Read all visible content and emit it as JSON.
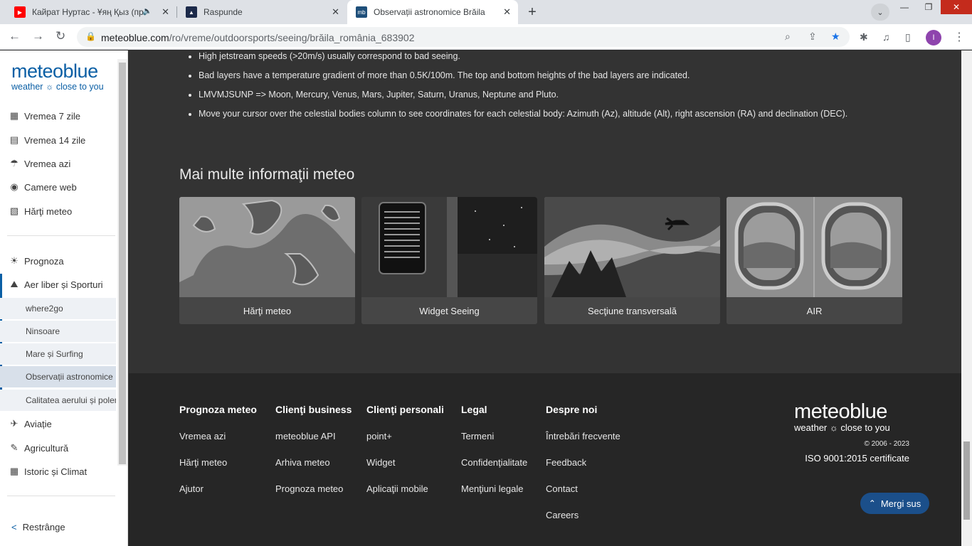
{
  "browser": {
    "tabs": [
      {
        "title": "Кайрат Нуртас - Ұяң Қыз (пр",
        "favicon": "youtube-icon"
      },
      {
        "title": "Raspunde",
        "favicon": "raspunde-icon"
      },
      {
        "title": "Observații astronomice Brăila - m",
        "favicon": "mb-icon",
        "favicon_text": "mb"
      }
    ],
    "url_host": "meteoblue.com",
    "url_path": "/ro/vreme/outdoorsports/seeing/brăila_românia_683902",
    "profile_initial": "I"
  },
  "sidebar": {
    "logo_main": "meteoblue",
    "logo_tagline": "weather ☼ close to you",
    "items_top": [
      {
        "label": "Vremea 7 zile",
        "icon": "calendar-7-icon"
      },
      {
        "label": "Vremea 14 zile",
        "icon": "calendar-14-icon"
      },
      {
        "label": "Vremea azi",
        "icon": "weather-today-icon"
      },
      {
        "label": "Camere web",
        "icon": "webcam-icon"
      },
      {
        "label": "Hărţi meteo",
        "icon": "map-icon"
      }
    ],
    "items_mid": [
      {
        "label": "Prognoza",
        "icon": "forecast-icon"
      },
      {
        "label": "Aer liber și Sporturi",
        "icon": "outdoor-icon"
      }
    ],
    "subitems": [
      {
        "label": "where2go"
      },
      {
        "label": "Ninsoare"
      },
      {
        "label": "Mare și Surfing"
      },
      {
        "label": "Observații astronomice"
      },
      {
        "label": "Calitatea aerului și polen"
      }
    ],
    "items_bottom": [
      {
        "label": "Aviație",
        "icon": "airplane-icon"
      },
      {
        "label": "Agricultură",
        "icon": "agriculture-icon"
      },
      {
        "label": "Istoric și Climat",
        "icon": "history-icon"
      }
    ],
    "collapse_label": "Restrânge"
  },
  "content": {
    "bullets": [
      "High jetstream speeds (>20m/s) usually correspond to bad seeing.",
      "Bad layers have a temperature gradient of more than 0.5K/100m. The top and bottom heights of the bad layers are indicated.",
      "LMVMJSUNP => Moon, Mercury, Venus, Mars, Jupiter, Saturn, Uranus, Neptune and Pluto.",
      "Move your cursor over the celestial bodies column to see coordinates for each celestial body: Azimuth (Az), altitude (Alt), right ascension (RA) and declination (DEC)."
    ],
    "section_title": "Mai multe informaţii meteo",
    "cards": [
      {
        "caption": "Hărţi meteo"
      },
      {
        "caption": "Widget Seeing"
      },
      {
        "caption": "Secţiune transversală"
      },
      {
        "caption": "AIR"
      }
    ]
  },
  "footer": {
    "columns": [
      {
        "heading": "Prognoza meteo",
        "links": [
          "Vremea azi",
          "Hărţi meteo",
          "Ajutor"
        ]
      },
      {
        "heading": "Clienţi business",
        "links": [
          "meteoblue API",
          "Arhiva meteo",
          "Prognoza meteo"
        ]
      },
      {
        "heading": "Clienţi personali",
        "links": [
          "point+",
          "Widget",
          "Aplicaţii mobile"
        ]
      },
      {
        "heading": "Legal",
        "links": [
          "Termeni",
          "Confidenţialitate",
          "Menţiuni legale"
        ]
      },
      {
        "heading": "Despre noi",
        "links": [
          "Întrebări frecvente",
          "Feedback",
          "Contact",
          "Careers"
        ]
      }
    ],
    "logo_main": "meteoblue",
    "logo_tagline": "weather ☼ close to you",
    "copyright": "© 2006 - 2023",
    "iso": "ISO 9001:2015 certificate",
    "go_top_label": "Mergi sus"
  }
}
